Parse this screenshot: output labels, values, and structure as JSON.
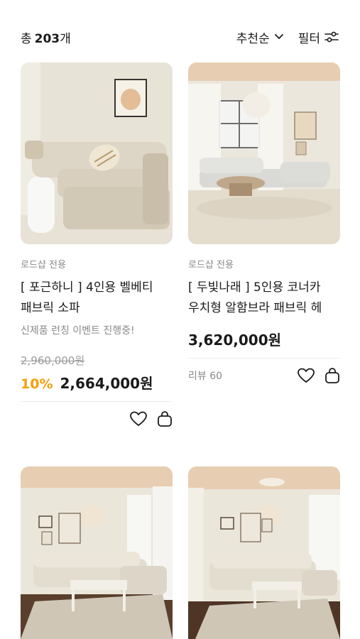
{
  "header": {
    "count_prefix": "총",
    "count_value": "203",
    "count_suffix": "개",
    "sort_label": "추천순",
    "filter_label": "필터"
  },
  "products": [
    {
      "seller": "로드샵 전용",
      "title_line1": "[ 포근하니 ] 4인용 벨베티",
      "title_line2": "패브릭 소파",
      "promo": "신제품 런칭 이벤트 진행중!",
      "original_price": "2,960,000원",
      "discount": "10%",
      "price": "2,664,000원"
    },
    {
      "seller": "로드샵 전용",
      "title_line1": "[ 두빛나래 ] 5인용 코너카",
      "title_line2": "우치형 알함브라 패브릭 헤",
      "price": "3,620,000원",
      "review_label": "리뷰",
      "review_count": "60"
    }
  ],
  "icons": {
    "sort": "chevron-down-icon",
    "filter": "sliders-icon",
    "wishlist": "heart-icon",
    "cart": "shopping-bag-icon"
  },
  "colors": {
    "discount": "#f59e0b",
    "muted_text": "#8a8a8a"
  }
}
